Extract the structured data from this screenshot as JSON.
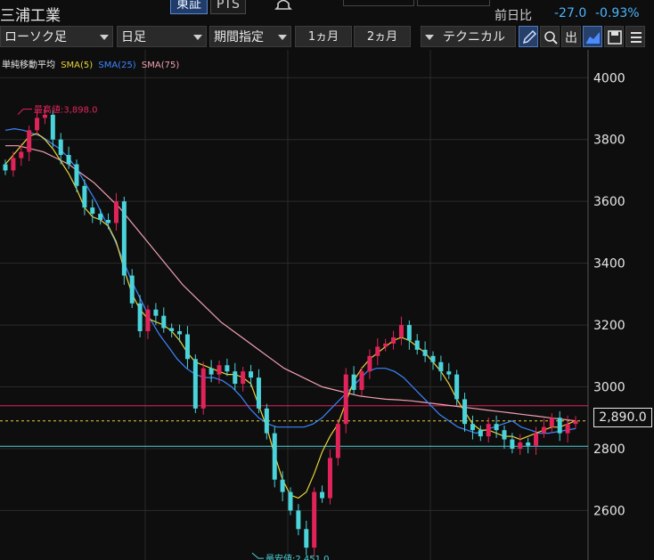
{
  "header": {
    "stock_name": "三浦工業",
    "exchange_tabs": [
      "東証",
      "PTS"
    ],
    "change_label": "前日比",
    "change_value": "-27.0",
    "change_percent": "-0.93%"
  },
  "toolbar": {
    "chart_type": "ローソク足",
    "period": "日足",
    "range_select": "期間指定",
    "btn_1m": "1ヵ月",
    "btn_2m": "2ヵ月",
    "technical": "テクニカル",
    "icons": [
      "pen-icon",
      "zoom-icon",
      "volume-out-icon",
      "line-chart-icon",
      "save-icon",
      "menu-icon"
    ]
  },
  "legend": {
    "title": "単純移動平均",
    "sma5": "SMA(5)",
    "sma25": "SMA(25)",
    "sma75": "SMA(75)"
  },
  "colors": {
    "up": "#e0245a",
    "down": "#4bd3da",
    "sma5": "#e8d23a",
    "sma25": "#3c86ff",
    "sma75": "#f0a0b0",
    "resistance": "#e0245a",
    "support": "#4bd3da",
    "last": "#e8d23a"
  },
  "annotations": {
    "high_label": "最高値:3,898.0",
    "low_label": "最安値:2,451.0"
  },
  "current_price": "2,890.0",
  "chart_data": {
    "type": "candlestick",
    "ylim": [
      2440,
      4090
    ],
    "y_ticks": [
      "4000",
      "3800",
      "3600",
      "3400",
      "3200",
      "3000",
      "2800",
      "2600"
    ],
    "y_tick_values": [
      4000,
      3800,
      3600,
      3400,
      3200,
      3000,
      2800,
      2600
    ],
    "high": 3898,
    "low": 2451,
    "last": 2890,
    "resistance": 2939,
    "support": 2808,
    "close": [
      3700,
      3740,
      3760,
      3830,
      3870,
      3880,
      3800,
      3750,
      3720,
      3650,
      3580,
      3560,
      3540,
      3530,
      3600,
      3360,
      3270,
      3180,
      3250,
      3230,
      3190,
      3180,
      3170,
      3090,
      2930,
      3060,
      3040,
      3070,
      3050,
      3010,
      3050,
      3030,
      2930,
      2850,
      2700,
      2660,
      2600,
      2540,
      2480,
      2660,
      2640,
      2770,
      2880,
      3040,
      2990,
      3050,
      3100,
      3130,
      3140,
      3160,
      3200,
      3150,
      3120,
      3100,
      3080,
      3050,
      3040,
      2960,
      2880,
      2860,
      2840,
      2880,
      2860,
      2830,
      2800,
      2820,
      2810,
      2850,
      2870,
      2900,
      2850,
      2880,
      2890
    ],
    "sma5": [
      3720,
      3750,
      3780,
      3810,
      3820,
      3800,
      3770,
      3730,
      3690,
      3640,
      3580,
      3550,
      3540,
      3520,
      3470,
      3380,
      3300,
      3250,
      3220,
      3210,
      3200,
      3180,
      3150,
      3110,
      3080,
      3070,
      3060,
      3050,
      3040,
      3040,
      3030,
      3010,
      2940,
      2870,
      2780,
      2700,
      2650,
      2640,
      2660,
      2720,
      2790,
      2840,
      2880,
      2950,
      3020,
      3060,
      3090,
      3110,
      3130,
      3150,
      3160,
      3150,
      3130,
      3110,
      3080,
      3050,
      3010,
      2960,
      2920,
      2880,
      2860,
      2860,
      2850,
      2840,
      2840,
      2830,
      2840,
      2850,
      2860,
      2870,
      2870,
      2880,
      2890
    ],
    "sma25": [
      3830,
      3835,
      3830,
      3820,
      3810,
      3790,
      3770,
      3740,
      3700,
      3650,
      3600,
      3540,
      3480,
      3410,
      3340,
      3280,
      3220,
      3170,
      3130,
      3090,
      3060,
      3040,
      3030,
      3030,
      3020,
      3000,
      2970,
      2930,
      2900,
      2880,
      2870,
      2870,
      2870,
      2870,
      2880,
      2900,
      2930,
      2960,
      2990,
      3020,
      3050,
      3060,
      3060,
      3050,
      3030,
      3000,
      2970,
      2940,
      2910,
      2890,
      2870,
      2860,
      2850,
      2860,
      2870,
      2880,
      2890,
      2870,
      2860,
      2850,
      2850,
      2855,
      2860,
      2865
    ],
    "sma75": [
      3780,
      3780,
      3770,
      3760,
      3740,
      3720,
      3690,
      3660,
      3620,
      3580,
      3530,
      3480,
      3430,
      3380,
      3330,
      3290,
      3250,
      3210,
      3180,
      3150,
      3120,
      3090,
      3060,
      3040,
      3020,
      3000,
      2990,
      2980,
      2970,
      2965,
      2960,
      2958,
      2955,
      2950,
      2945,
      2940,
      2935,
      2930,
      2925,
      2920,
      2915,
      2910,
      2905,
      2900,
      2895,
      2890
    ]
  }
}
